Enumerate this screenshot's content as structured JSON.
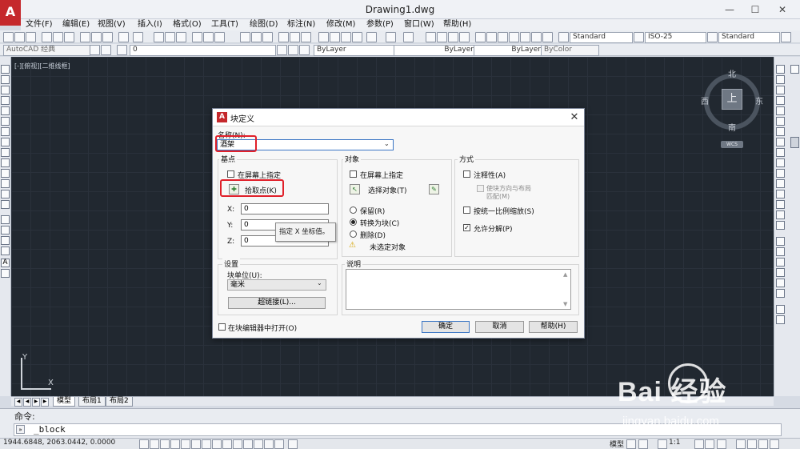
{
  "window": {
    "title": "Drawing1.dwg",
    "logo": "A",
    "controls": [
      "—",
      "☐",
      "✕"
    ]
  },
  "menu": {
    "items": [
      "文件(F)",
      "编辑(E)",
      "视图(V)",
      "插入(I)",
      "格式(O)",
      "工具(T)",
      "绘图(D)",
      "标注(N)",
      "修改(M)",
      "参数(P)",
      "窗口(W)",
      "帮助(H)"
    ]
  },
  "toolbar": {
    "text_style": "Standard",
    "dim_style": "ISO-25",
    "table_style": "Standard",
    "workspace": "AutoCAD 经典",
    "layer": "0",
    "color": "ByLayer",
    "linetype": "ByLayer",
    "lineweight": "ByLayer",
    "plotstyle": "ByColor"
  },
  "viewport": {
    "label": "[-][俯视][二维线框]"
  },
  "viewcube": {
    "top_face": "上",
    "north": "北",
    "south": "南",
    "east": "东",
    "west": "西",
    "wcs": "WCS"
  },
  "ucs": {
    "x": "X",
    "y": "Y"
  },
  "layout_tabs": {
    "nav": [
      "◀",
      "◀",
      "▶",
      "▶"
    ],
    "tabs": [
      {
        "label": "模型",
        "active": true
      },
      {
        "label": "布局1",
        "active": false
      },
      {
        "label": "布局2",
        "active": false
      }
    ]
  },
  "command": {
    "history": "命令:",
    "current": "_block",
    "icon": "»"
  },
  "status": {
    "coords": "1944.6848, 2063.0442, 0.0000",
    "model": "模型",
    "scale": "1:1"
  },
  "dialog": {
    "logo": "A",
    "title": "块定义",
    "close": "✕",
    "name_label": "名称(N):",
    "name_value": "酒架",
    "base_point": {
      "title": "基点",
      "specify_on_screen": "在屏幕上指定",
      "pick_point": "拾取点(K)",
      "x_label": "X:",
      "y_label": "Y:",
      "z_label": "Z:",
      "x_value": "0",
      "y_value": "0",
      "z_value": "0"
    },
    "tooltip": "指定 X 坐标值。",
    "objects": {
      "title": "对象",
      "specify_on_screen": "在屏幕上指定",
      "select_objects": "选择对象(T)",
      "retain": "保留(R)",
      "convert": "转换为块(C)",
      "delete": "删除(D)",
      "warning": "未选定对象",
      "selected_option": "convert"
    },
    "behavior": {
      "title": "方式",
      "annotative": "注释性(A)",
      "match_orientation_1": "使块方向与布局",
      "match_orientation_2": "匹配(M)",
      "scale_uniformly": "按统一比例缩放(S)",
      "allow_exploding": "允许分解(P)",
      "allow_exploding_checked": true
    },
    "settings": {
      "title": "设置",
      "block_unit_label": "块单位(U):",
      "block_unit_value": "毫米",
      "hyperlink": "超链接(L)..."
    },
    "description": {
      "title": "说明",
      "value": ""
    },
    "open_in_editor": "在块编辑器中打开(O)",
    "ok": "确定",
    "cancel": "取消",
    "help": "帮助(H)"
  },
  "watermark": {
    "brand": "Bai  经验",
    "url": "jingyan.baidu.com"
  },
  "colors": {
    "canvas": "#212830",
    "accent": "#c5282c",
    "highlight": "#e0202a"
  }
}
